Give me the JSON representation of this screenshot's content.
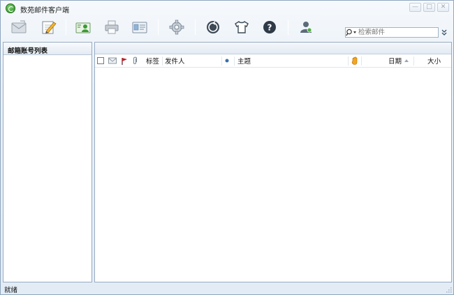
{
  "window": {
    "title": "数苑邮件客户端",
    "controls": {
      "minimize": "—",
      "maximize": "□",
      "close": "✕"
    }
  },
  "toolbar": {
    "buttons": [
      {
        "name": "receive-mail",
        "icon": "envelope-icon"
      },
      {
        "name": "compose",
        "icon": "compose-pencil-icon"
      },
      {
        "name": "contacts",
        "icon": "contact-card-icon"
      },
      {
        "name": "print",
        "icon": "printer-icon"
      },
      {
        "name": "address-book",
        "icon": "address-card-icon"
      },
      {
        "name": "settings",
        "icon": "gear-icon"
      },
      {
        "name": "update",
        "icon": "globe-icon"
      },
      {
        "name": "skin",
        "icon": "tshirt-icon"
      },
      {
        "name": "help",
        "icon": "help-icon"
      },
      {
        "name": "account",
        "icon": "user-icon"
      }
    ],
    "search": {
      "placeholder": "检索邮件",
      "value": ""
    }
  },
  "left_panel": {
    "title": "邮箱账号列表"
  },
  "mail_list": {
    "columns": {
      "tag": "标签",
      "sender": "发件人",
      "subject": "主题",
      "date": "日期",
      "size": "大小"
    },
    "rows": []
  },
  "statusbar": {
    "text": "就绪"
  },
  "colors": {
    "accent": "#3a6fb0",
    "flag": "#c0202a",
    "panel_border": "#98acc2"
  }
}
